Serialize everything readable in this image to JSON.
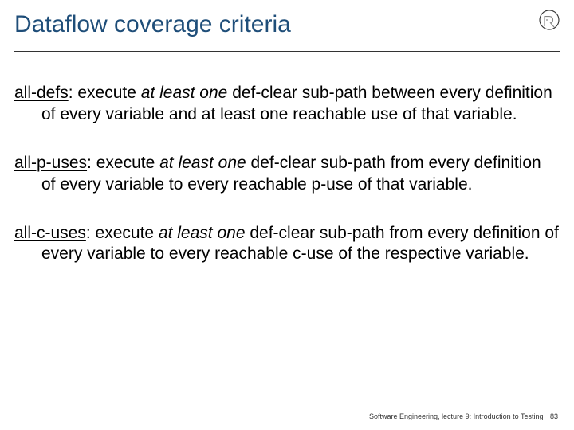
{
  "title": "Dataflow coverage criteria",
  "logo": "chair-logo",
  "defs": [
    {
      "term": "all-defs",
      "sep": ": execute ",
      "em": "at least one",
      "rest": " def-clear sub-path between every definition of every variable and at least one reachable use of that variable."
    },
    {
      "term": "all-p-uses",
      "sep": ": execute ",
      "em": "at least one",
      "rest": " def-clear sub-path from every definition of every variable to every reachable p-use of that variable."
    },
    {
      "term": "all-c-uses",
      "sep": ": execute ",
      "em": "at least one",
      "rest": " def-clear sub-path from every definition of every variable to every reachable c-use of the respective variable."
    }
  ],
  "footer": {
    "text": "Software Engineering, lecture 9: Introduction to Testing",
    "page": "83"
  }
}
